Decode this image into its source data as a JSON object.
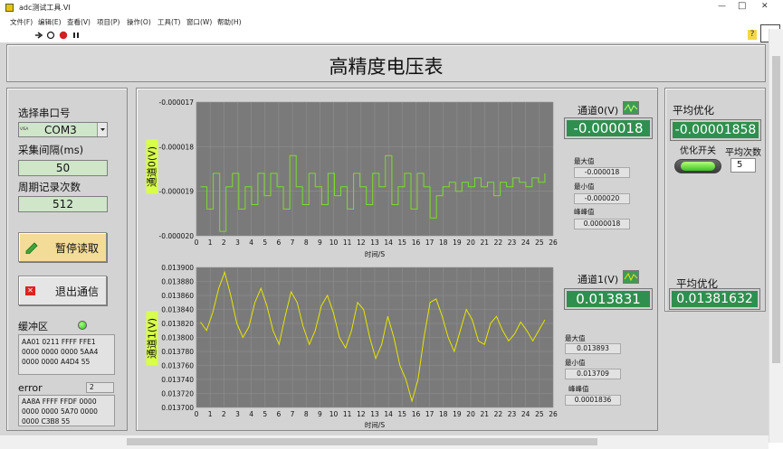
{
  "window": {
    "title": "adc测试工具.VI",
    "min_symbol": "—",
    "max_symbol": "□",
    "close_symbol": "✕"
  },
  "menu": [
    "文件(F)",
    "编辑(E)",
    "查看(V)",
    "项目(P)",
    "操作(O)",
    "工具(T)",
    "窗口(W)",
    "帮助(H)"
  ],
  "header": {
    "title": "高精度电压表"
  },
  "left": {
    "serial_label": "选择串口号",
    "serial_value": "COM3",
    "serial_prefix": "VISA",
    "interval_label": "采集间隔(ms)",
    "interval_value": "50",
    "count_label": "周期记录次数",
    "count_value": "512",
    "pause_button": "暂停读取",
    "exit_button": "退出通信",
    "buffer_label": "缓冲区",
    "buffer_text": "AA01 0211 FFFF FFE1 0000 0000 0000 5AA4 0000 0000 A4D4 55",
    "error_label": "error",
    "error_count": "2",
    "error_text": "AA8A FFFF FFDF 0000 0000 0000 5A70 0000 0000 C3B8 55"
  },
  "ch0": {
    "ylabel": "通道0(V)",
    "xlabel": "时间/S",
    "value_label": "通道0(V)",
    "value": "-0.000018",
    "max_label": "最大值",
    "max": "-0.000018",
    "min_label": "最小值",
    "min": "-0.000020",
    "pp_label": "峰峰值",
    "pp": "0.0000018"
  },
  "ch1": {
    "ylabel": "通道1(V)",
    "xlabel": "时间/S",
    "value_label": "通道1(V)",
    "value": "0.013831",
    "max_label": "最大值",
    "max": "0.013893",
    "min_label": "最小值",
    "min": "0.013709",
    "pp_label": "峰峰值",
    "pp": "0.0001836"
  },
  "right": {
    "avg_label_1": "平均优化",
    "avg_value_1": "-0.00001858",
    "switch_label": "优化开关",
    "times_label": "平均次数",
    "times_value": "5",
    "avg_label_2": "平均优化",
    "avg_value_2": "0.01381632"
  },
  "colors": {
    "plot_bg": "#7a7a7a",
    "trace0": "#7ddc2a",
    "trace1": "#e6e600",
    "indicator": "#2f8f4f"
  },
  "chart_data": [
    {
      "type": "line",
      "xlabel": "时间/S",
      "ylabel": "通道0(V)",
      "xlim": [
        0,
        26
      ],
      "ylim": [
        -2e-05,
        -1.7e-05
      ],
      "x_ticks": [
        "0",
        "1",
        "2",
        "3",
        "4",
        "5",
        "6",
        "7",
        "8",
        "9",
        "10",
        "11",
        "12",
        "13",
        "14",
        "15",
        "16",
        "17",
        "18",
        "19",
        "20",
        "21",
        "22",
        "23",
        "24",
        "25",
        "26"
      ],
      "y_ticks": [
        "-0.000017",
        "-0.000018",
        "-0.000019",
        "-0.000020"
      ],
      "series": [
        {
          "values": [
            -1.89e-05,
            -1.94e-05,
            -1.86e-05,
            -1.99e-05,
            -1.89e-05,
            -1.86e-05,
            -1.94e-05,
            -1.89e-05,
            -1.93e-05,
            -1.86e-05,
            -1.91e-05,
            -1.86e-05,
            -1.89e-05,
            -1.94e-05,
            -1.82e-05,
            -1.89e-05,
            -1.93e-05,
            -1.86e-05,
            -1.89e-05,
            -1.93e-05,
            -1.86e-05,
            -1.91e-05,
            -1.89e-05,
            -1.94e-05,
            -1.86e-05,
            -1.89e-05,
            -1.93e-05,
            -1.86e-05,
            -1.89e-05,
            -1.82e-05,
            -1.93e-05,
            -1.89e-05,
            -1.86e-05,
            -1.94e-05,
            -1.86e-05,
            -1.89e-05,
            -1.96e-05,
            -1.91e-05,
            -1.89e-05,
            -1.88e-05,
            -1.9e-05,
            -1.88e-05,
            -1.89e-05,
            -1.87e-05,
            -1.89e-05,
            -1.88e-05,
            -1.91e-05,
            -1.88e-05,
            -1.89e-05,
            -1.87e-05,
            -1.88e-05,
            -1.89e-05,
            -1.87e-05,
            -1.88e-05,
            -1.86e-05
          ]
        }
      ]
    },
    {
      "type": "line",
      "xlabel": "时间/S",
      "ylabel": "通道1(V)",
      "xlim": [
        0,
        26
      ],
      "ylim": [
        0.0137,
        0.0139
      ],
      "x_ticks": [
        "0",
        "1",
        "2",
        "3",
        "4",
        "5",
        "6",
        "7",
        "8",
        "9",
        "10",
        "11",
        "12",
        "13",
        "14",
        "15",
        "16",
        "17",
        "18",
        "19",
        "20",
        "21",
        "22",
        "23",
        "24",
        "25",
        "26"
      ],
      "y_ticks": [
        "0.013900",
        "0.013880",
        "0.013860",
        "0.013840",
        "0.013820",
        "0.013800",
        "0.013780",
        "0.013760",
        "0.013740",
        "0.013720",
        "0.013700"
      ],
      "series": [
        {
          "values": [
            0.013822,
            0.01381,
            0.013835,
            0.01387,
            0.013893,
            0.01386,
            0.01382,
            0.0138,
            0.013815,
            0.01385,
            0.01387,
            0.013845,
            0.01381,
            0.01379,
            0.01383,
            0.013865,
            0.01385,
            0.013815,
            0.01379,
            0.01381,
            0.013845,
            0.01386,
            0.013835,
            0.0138,
            0.013785,
            0.01381,
            0.01385,
            0.01384,
            0.0138,
            0.01377,
            0.01379,
            0.01383,
            0.0138,
            0.01376,
            0.01374,
            0.013709,
            0.01374,
            0.0138,
            0.01385,
            0.013855,
            0.01383,
            0.0138,
            0.01378,
            0.01381,
            0.01384,
            0.013825,
            0.013795,
            0.01379,
            0.01382,
            0.01383,
            0.01381,
            0.013795,
            0.013805,
            0.013822,
            0.01381,
            0.013795,
            0.01381,
            0.013825
          ]
        }
      ]
    }
  ]
}
